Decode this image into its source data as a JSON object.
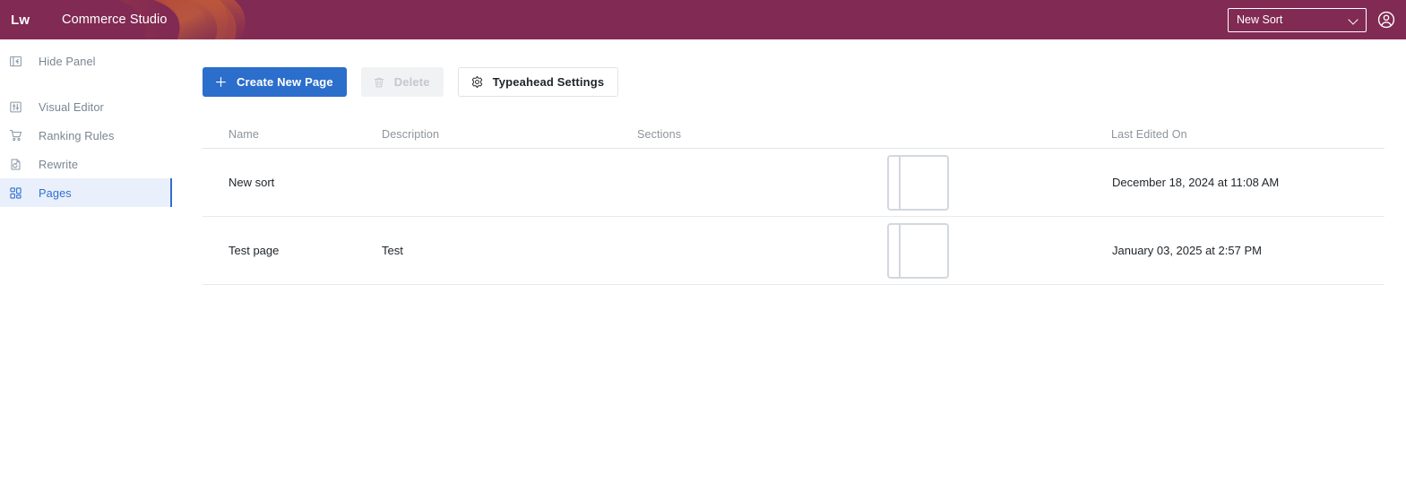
{
  "header": {
    "logo_text": "Lw",
    "title": "Commerce Studio",
    "sort_select": {
      "value": "New Sort",
      "icon": "chevron-down-icon"
    },
    "account_icon": "account-circle-icon",
    "background_color": "#812a53",
    "decor_color": "#c4593a"
  },
  "sidebar": {
    "hide_panel": {
      "label": "Hide Panel",
      "icon": "collapse-panel-icon"
    },
    "items": [
      {
        "label": "Visual Editor",
        "icon": "sliders-icon",
        "active": false
      },
      {
        "label": "Ranking Rules",
        "icon": "cart-icon",
        "active": false
      },
      {
        "label": "Rewrite",
        "icon": "rewrite-icon",
        "active": false
      },
      {
        "label": "Pages",
        "icon": "grid-icon",
        "active": true
      }
    ],
    "active_color": "#2f6fd0",
    "active_background": "#e9f0fb"
  },
  "toolbar": {
    "create_label": "Create New Page",
    "create_icon": "plus-icon",
    "delete_label": "Delete",
    "delete_icon": "trash-icon",
    "delete_disabled": true,
    "typeahead_label": "Typeahead Settings",
    "typeahead_icon": "gear-icon",
    "primary_color": "#2c6ecb"
  },
  "table": {
    "columns": [
      "Name",
      "Description",
      "Sections",
      "Last Edited On"
    ],
    "rows": [
      {
        "name": "New sort",
        "description": "",
        "sections_thumbnail": "two-column-layout-thumbnail",
        "last_edited_on": "December 18, 2024 at 11:08 AM"
      },
      {
        "name": "Test page",
        "description": "Test",
        "sections_thumbnail": "two-column-layout-thumbnail",
        "last_edited_on": "January 03, 2025 at 2:57 PM"
      }
    ]
  }
}
